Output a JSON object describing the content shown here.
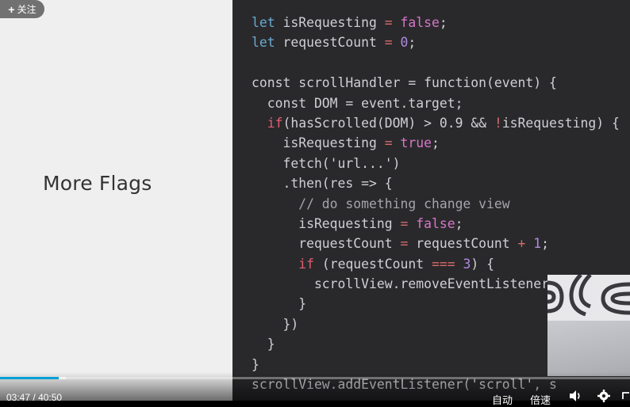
{
  "slide": {
    "title": "More Flags"
  },
  "follow_button": {
    "icon": "plus-icon",
    "label": "关注"
  },
  "code": [
    [
      [
        "let",
        "kw-let"
      ],
      [
        " isRequesting ",
        ""
      ],
      [
        "=",
        "kw-op"
      ],
      [
        " ",
        ""
      ],
      [
        "false",
        "kw-bool"
      ],
      [
        ";",
        ""
      ]
    ],
    [
      [
        "let",
        "kw-let"
      ],
      [
        " requestCount ",
        ""
      ],
      [
        "=",
        "kw-op"
      ],
      [
        " ",
        ""
      ],
      [
        "0",
        "kw-num"
      ],
      [
        ";",
        ""
      ]
    ],
    [
      [
        "",
        ""
      ]
    ],
    [
      [
        "const scrollHandler = function(event) {",
        ""
      ]
    ],
    [
      [
        "  const DOM = event.target;",
        ""
      ]
    ],
    [
      [
        "  ",
        ""
      ],
      [
        "if",
        "kw-if"
      ],
      [
        "(hasScrolled(DOM) > 0.9 && ",
        ""
      ],
      [
        "!",
        "kw-op"
      ],
      [
        "isRequesting) {",
        ""
      ]
    ],
    [
      [
        "    isRequesting ",
        ""
      ],
      [
        "=",
        "kw-op"
      ],
      [
        " ",
        ""
      ],
      [
        "true",
        "kw-bool"
      ],
      [
        ";",
        ""
      ]
    ],
    [
      [
        "    fetch('url...')",
        ""
      ]
    ],
    [
      [
        "    .then(res => {",
        ""
      ]
    ],
    [
      [
        "      // do something change view",
        "kw-comment"
      ]
    ],
    [
      [
        "      isRequesting ",
        ""
      ],
      [
        "=",
        "kw-op"
      ],
      [
        " ",
        ""
      ],
      [
        "false",
        "kw-bool"
      ],
      [
        ";",
        ""
      ]
    ],
    [
      [
        "      requestCount ",
        ""
      ],
      [
        "=",
        "kw-op"
      ],
      [
        " requestCount ",
        ""
      ],
      [
        "+",
        "kw-op"
      ],
      [
        " ",
        ""
      ],
      [
        "1",
        "kw-num"
      ],
      [
        ";",
        ""
      ]
    ],
    [
      [
        "      ",
        ""
      ],
      [
        "if",
        "kw-if"
      ],
      [
        " (requestCount ",
        ""
      ],
      [
        "===",
        "kw-op"
      ],
      [
        " ",
        ""
      ],
      [
        "3",
        "kw-num"
      ],
      [
        ") {",
        ""
      ]
    ],
    [
      [
        "        scrollView.removeEventListener",
        ""
      ]
    ],
    [
      [
        "      }",
        ""
      ]
    ],
    [
      [
        "    })",
        ""
      ]
    ],
    [
      [
        "  }",
        ""
      ]
    ],
    [
      [
        "}",
        ""
      ]
    ],
    [
      [
        "scrollView.addEventListener('scroll', s",
        ""
      ]
    ]
  ],
  "player": {
    "current_time": "03:47",
    "separator": "/",
    "duration": "40:50",
    "progress": 0.0927,
    "buffered": 0.105,
    "auto_label": "自动",
    "speed_label": "倍速",
    "volume_icon": "volume-icon",
    "settings_icon": "gear-icon",
    "fullscreen_icon": "fullscreen-icon"
  },
  "colors": {
    "accent": "#00a1d6",
    "code_bg": "#29292c",
    "slide_bg": "#efefef"
  }
}
